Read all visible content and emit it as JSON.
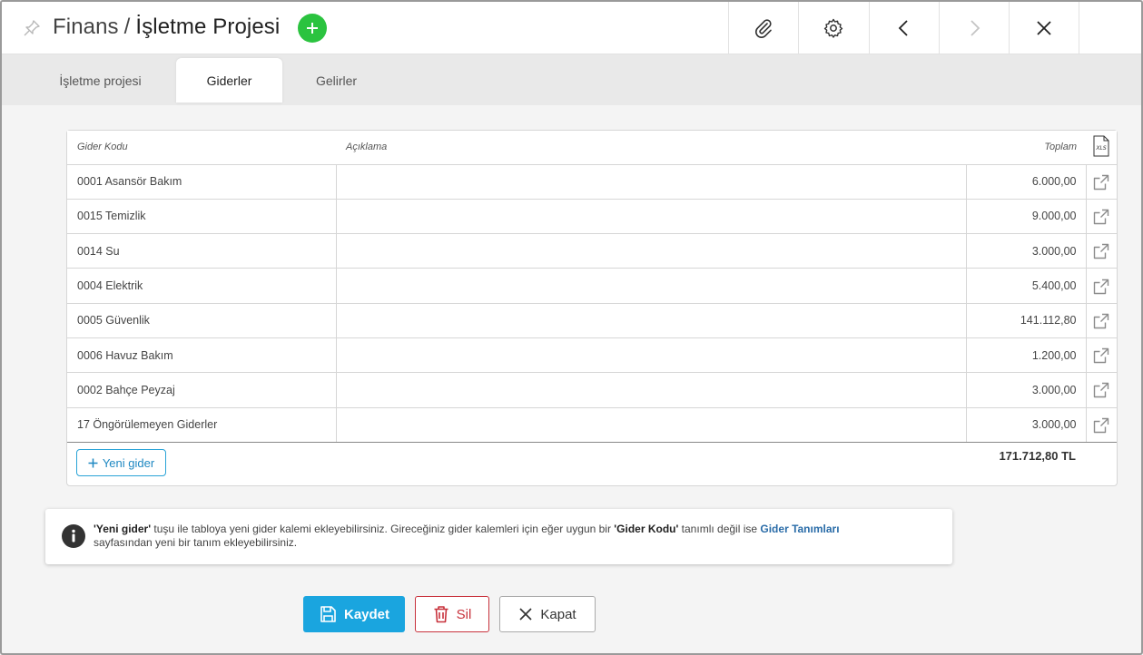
{
  "header": {
    "module": "Finans",
    "separator": "/",
    "title": "İşletme Projesi",
    "buttons": [
      "paperclip-icon",
      "gear-icon",
      "chevron-left-icon",
      "chevron-right-icon",
      "close-icon"
    ]
  },
  "tabs": [
    {
      "label": "İşletme projesi",
      "active": false
    },
    {
      "label": "Giderler",
      "active": true
    },
    {
      "label": "Gelirler",
      "active": false
    }
  ],
  "table": {
    "columns": {
      "code": "Gider Kodu",
      "desc": "Açıklama",
      "total": "Toplam"
    },
    "xls_label": "XLS",
    "rows": [
      {
        "code": "0001 Asansör Bakım",
        "desc": "",
        "total": "6.000,00"
      },
      {
        "code": "0015 Temizlik",
        "desc": "",
        "total": "9.000,00"
      },
      {
        "code": "0014 Su",
        "desc": "",
        "total": "3.000,00"
      },
      {
        "code": "0004 Elektrik",
        "desc": "",
        "total": "5.400,00"
      },
      {
        "code": "0005 Güvenlik",
        "desc": "",
        "total": "141.112,80"
      },
      {
        "code": "0006 Havuz Bakım",
        "desc": "",
        "total": "1.200,00"
      },
      {
        "code": "0002 Bahçe Peyzaj",
        "desc": "",
        "total": "3.000,00"
      },
      {
        "code": "17 Öngörülemeyen Giderler",
        "desc": "",
        "total": "3.000,00"
      }
    ],
    "grand_total": "171.712,80 TL",
    "new_button": "Yeni gider"
  },
  "info": {
    "q1": "'Yeni gider'",
    "t1": " tuşu ile tabloya yeni gider kalemi ekleyebilirsiniz. Gireceğiniz gider kalemleri için eğer uygun bir ",
    "q2": "'Gider Kodu'",
    "t2": " tanımlı değil ise ",
    "link": "Gider Tanımları",
    "t3": "sayfasından yeni bir tanım ekleyebilirsiniz."
  },
  "actions": {
    "save": "Kaydet",
    "delete": "Sil",
    "close": "Kapat"
  },
  "colors": {
    "accent": "#1aa5df",
    "add": "#2bc33f",
    "danger": "#c8323c",
    "link": "#2a6ca8"
  }
}
